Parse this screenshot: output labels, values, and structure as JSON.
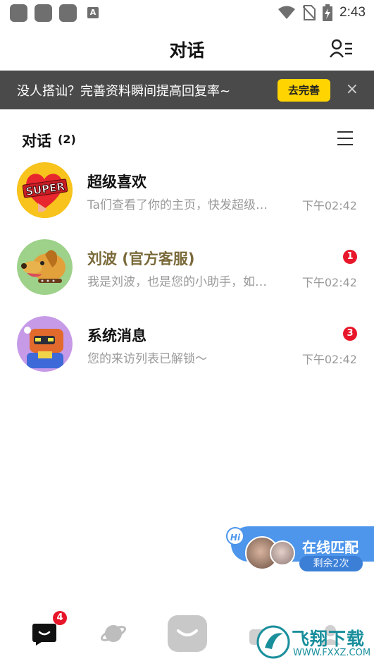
{
  "status_bar": {
    "notif_letter": "A",
    "time": "2:43"
  },
  "header": {
    "title": "对话",
    "contacts_icon": "contacts-list-icon"
  },
  "banner": {
    "text": "没人搭讪？完善资料瞬间提高回复率~",
    "action_label": "去完善",
    "close_symbol": "×",
    "accent": "#ffd400"
  },
  "section": {
    "title": "对话",
    "count": "(2)"
  },
  "conversations": [
    {
      "name": "超级喜欢",
      "preview": "Ta们查看了你的主页，快发超级…",
      "time": "下午02:42",
      "badge": "",
      "avatar_text": "SUPER"
    },
    {
      "name": "刘波 (官方客服)",
      "preview": "我是刘波，也是您的小助手，如…",
      "time": "下午02:42",
      "badge": "1",
      "avatar_text": ""
    },
    {
      "name": "系统消息",
      "preview": "您的来访列表已解锁〜",
      "time": "下午02:42",
      "badge": "3",
      "avatar_text": ""
    }
  ],
  "match": {
    "hi": "Hi",
    "title": "在线匹配",
    "remaining": "剩余2次",
    "color": "#4d96ec"
  },
  "bottom_nav": {
    "messages_badge": "4"
  },
  "watermark": {
    "text": "飞翔下载",
    "url": "WWW.FXXZ.COM"
  }
}
